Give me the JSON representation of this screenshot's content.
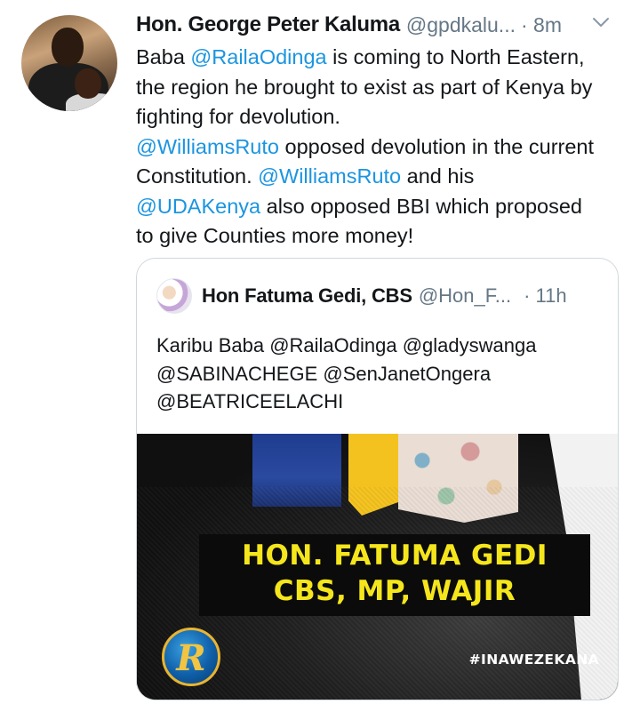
{
  "tweet": {
    "author_name": "Hon. George Peter Kaluma",
    "author_handle": "@gpdkalu...",
    "timestamp": "· 8m",
    "text_lines": [
      [
        {
          "t": "Baba ",
          "m": false
        },
        {
          "t": "@RailaOdinga",
          "m": true
        },
        {
          "t": " is coming to North Eastern,",
          "m": false
        }
      ],
      [
        {
          "t": "the region he brought to exist as part of Kenya by",
          "m": false
        }
      ],
      [
        {
          "t": "fighting for devolution.",
          "m": false
        }
      ],
      [
        {
          "t": "@WilliamsRuto",
          "m": true
        },
        {
          "t": " opposed devolution in the current",
          "m": false
        }
      ],
      [
        {
          "t": "Constitution. ",
          "m": false
        },
        {
          "t": "@WilliamsRuto",
          "m": true
        },
        {
          "t": " and his",
          "m": false
        }
      ],
      [
        {
          "t": "@UDAKenya",
          "m": true
        },
        {
          "t": " also opposed BBI which proposed",
          "m": false
        }
      ],
      [
        {
          "t": "to give Counties more money!",
          "m": false
        }
      ]
    ]
  },
  "quoted_tweet": {
    "author_name": "Hon Fatuma Gedi, CBS",
    "author_handle": "@Hon_F...",
    "timestamp": "· 11h",
    "text_lines": [
      "Karibu Baba @RailaOdinga @gladyswanga",
      "@SABINACHEGE @SenJanetOngera",
      "@BEATRICEELACHI"
    ],
    "media": {
      "banner_line1": "HON. FATUMA GEDI",
      "banner_line2": "CBS, MP, WAJIR",
      "logo_letter": "R",
      "hashtag": "#INAWEZEKANA"
    }
  },
  "colors": {
    "mention": "#1b95e0",
    "secondary_text": "#657786",
    "banner_text": "#f5e61c",
    "border": "#d0d8de"
  },
  "icons": {
    "menu": "chevron-down-icon"
  }
}
